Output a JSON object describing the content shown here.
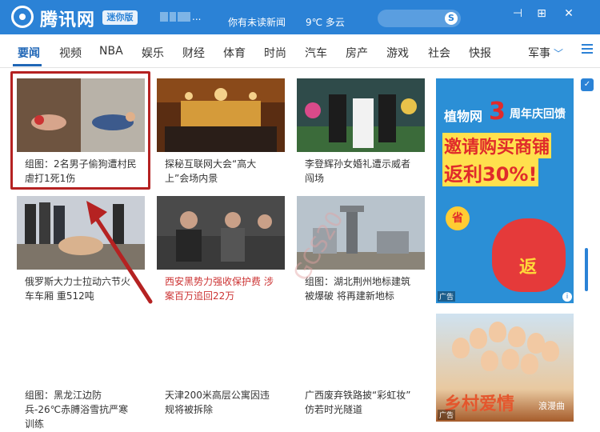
{
  "titlebar": {
    "brand": "腾讯网",
    "edition": "迷你版",
    "user_mask": "...",
    "unread": "你有未读新闻",
    "weather": "9℃  多云",
    "pin_icon": "pin-icon",
    "maximize_icon": "maximize-icon",
    "close_icon": "close-icon",
    "close_glyph": "✕",
    "maximize_glyph": "⊞",
    "pin_glyph": "⊣"
  },
  "nav": {
    "items": [
      "要闻",
      "视频",
      "NBA",
      "娱乐",
      "财经",
      "体育",
      "时尚",
      "汽车",
      "房产",
      "游戏",
      "社会",
      "快报"
    ],
    "more_label": "军事",
    "active_index": 0
  },
  "news": [
    {
      "caption": "组图：2名男子偷狗遭村民虐打1死1伤",
      "red": false
    },
    {
      "caption": "探秘互联网大会“高大上”会场内景",
      "red": false
    },
    {
      "caption": "李登辉孙女婚礼遭示威者闯场",
      "red": false
    },
    {
      "caption": "俄罗斯大力士拉动六节火车车厢 重512吨",
      "red": false
    },
    {
      "caption": "西安黑势力强收保护费 涉案百万追回22万",
      "red": true
    },
    {
      "caption": "组图：湖北荆州地标建筑被爆破 将再建新地标",
      "red": false
    },
    {
      "caption": "组图：黑龙江边防兵-26℃赤膊浴雪抗严寒训练",
      "red": false
    },
    {
      "caption": "天津200米高层公寓因违规将被拆除",
      "red": false
    },
    {
      "caption": "广西废弃铁路披“彩虹妆” 仿若时光隧道",
      "red": false
    }
  ],
  "ads": {
    "side": {
      "line_title": "植物网",
      "line_num": "3",
      "line_rest": "周年庆回馈",
      "line1": "邀请购买商铺",
      "line2": "返利30%!",
      "coin": "省",
      "bag": "返",
      "tag": "广告",
      "info": "i"
    },
    "side2": {
      "title": "乡村爱情",
      "sub": "浪漫曲",
      "tag": "广告"
    }
  },
  "watermark": "GCS20",
  "colors": {
    "header_blue": "#2b82d6",
    "nav_active": "#1f66b6",
    "highlight_red": "#b52222"
  }
}
